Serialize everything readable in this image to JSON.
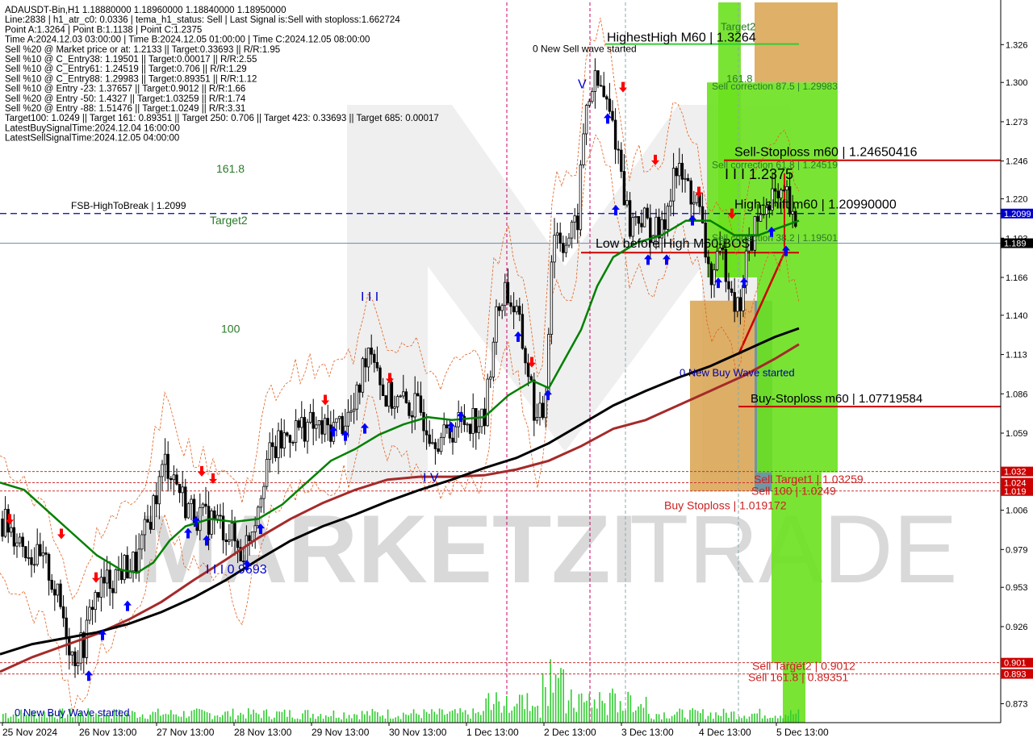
{
  "header_lines": [
    "ADAUSDT-Bin,H1  1.18880000 1.18960000 1.18840000 1.18950000",
    "Line:2838 | h1_atr_c0: 0.0336 | tema_h1_status: Sell | Last Signal is:Sell with stoploss:1.662724",
    "Point A:1.3264 | Point B:1.1138 | Point C:1.2375",
    "Time A:2024.12.03 03:00:00 | Time B:2024.12.05 01:00:00 | Time C:2024.12.05 08:00:00",
    "Sell %20 @ Market price or at: 1.2133 || Target:0.33693 || R/R:1.95",
    "Sell %10 @ C_Entry38: 1.19501 || Target:0.00017 || R/R:2.55",
    "Sell %10 @ C_Entry61: 1.24519 || Target:0.706 || R/R:1.29",
    "Sell %10 @ C_Entry88: 1.29983 || Target:0.89351 || R/R:1.12",
    "Sell %10 @ Entry -23: 1.37657 || Target:0.9012 || R/R:1.66",
    "Sell %20 @ Entry -50: 1.4327 || Target:1.03259 || R/R:1.74",
    "Sell %20 @ Entry -88: 1.51476 || Target:1.0249 || R/R:3.31",
    "Target100: 1.0249 || Target 161: 0.89351 || Target 250: 0.706 || Target 423: 0.33693 || Target 685: 0.00017",
    "LatestBuySignalTime:2024.12.04 16:00:00",
    "LatestSellSignalTime:2024.12.05 04:00:00"
  ],
  "watermark": {
    "brand": "MARKETZI",
    "suffix": "TRADE"
  },
  "colors": {
    "bull_green": "#6be11e",
    "orange_zone": "#d9a24e",
    "steel_zone": "#5f8c9a",
    "red_line": "#cc0000",
    "blue_dash": "#0000aa",
    "ema_green": "#008000",
    "ema_black": "#000000",
    "ema_darkred": "#a52a2a",
    "arrow_up": "#0000ff",
    "arrow_down": "#ff0000"
  },
  "chart_labels": {
    "left_fib_161": "161.8",
    "left_target2": "Target2",
    "left_100": "100",
    "fsb": "FSB-HighToBreak | 1.2099",
    "highest_high": "HighestHigh   M60 | 1.3264",
    "new_sell_wave": "0 New Sell wave started",
    "target2_top": "Target2",
    "fib_161_top": "161.8",
    "sell_corr_875": "Sell correction 87.5 | 1.29983",
    "sell_stoploss": "Sell-Stoploss m60 | 1.24650416",
    "sell_corr_618": "Sell correction 61.8 | 1.24519",
    "point_c": "I I I 1.2375",
    "high_shift": "High-shift m60 | 1.20990000",
    "low_before_high": "Low before High   M60-BOS",
    "sell_corr_382": "Sell correction 38.2 | 1.19501",
    "new_buy_wave_mid": "0 New Buy Wave started",
    "buy_stoploss": "Buy-Stoploss m60 | 1.07719584",
    "sell_target1": "Sell Target1 | 1.03259",
    "sell_100": "Sell 100 | 1.0249",
    "buy_stoploss_low": "Buy Stoploss | 1.019172",
    "sell_target2": "Sell Target2 | 0.9012",
    "sell_1618": "Sell 161.8 | 0.89351",
    "wave_low": "I I I 0.9693",
    "wave_iii": "I I I",
    "wave_iv": "I V",
    "wave_v": "V",
    "new_buy_wave_bottom": "0 New Buy Wave started"
  },
  "axis_badges": [
    {
      "text": "1.2099",
      "value": 1.2099,
      "bg": "#0000cc"
    },
    {
      "text": "1.189",
      "value": 1.1895,
      "bg": "#000000"
    },
    {
      "text": "1.032",
      "value": 1.0326,
      "bg": "#cc0000"
    },
    {
      "text": "1.024",
      "value": 1.0249,
      "bg": "#cc0000"
    },
    {
      "text": "1.019",
      "value": 1.0192,
      "bg": "#cc0000"
    },
    {
      "text": "0.901",
      "value": 0.9012,
      "bg": "#cc0000"
    },
    {
      "text": "0.893",
      "value": 0.8935,
      "bg": "#cc0000"
    }
  ],
  "chart_data": {
    "type": "candlestick",
    "symbol": "ADAUSDT-Bin",
    "timeframe": "H1",
    "y_ticks": [
      "1.326",
      "1.300",
      "1.273",
      "1.246",
      "1.220",
      "1.193",
      "1.166",
      "1.140",
      "1.113",
      "1.086",
      "1.059",
      "1.033",
      "1.006",
      "0.979",
      "0.953",
      "0.926",
      "0.873"
    ],
    "ylim": [
      0.86,
      1.355
    ],
    "x_ticks": [
      "25 Nov 2024",
      "26 Nov 13:00",
      "27 Nov 13:00",
      "28 Nov 13:00",
      "29 Nov 13:00",
      "30 Nov 13:00",
      "1 Dec 13:00",
      "2 Dec 13:00",
      "3 Dec 13:00",
      "4 Dec 13:00",
      "5 Dec 13:00"
    ],
    "close_path": [
      [
        0,
        1.0
      ],
      [
        20,
        0.99
      ],
      [
        40,
        0.975
      ],
      [
        60,
        0.965
      ],
      [
        80,
        0.93
      ],
      [
        90,
        0.905
      ],
      [
        105,
        0.915
      ],
      [
        115,
        0.945
      ],
      [
        130,
        0.955
      ],
      [
        150,
        0.965
      ],
      [
        170,
        0.97
      ],
      [
        190,
        1.01
      ],
      [
        205,
        1.04
      ],
      [
        215,
        1.03
      ],
      [
        230,
        1.01
      ],
      [
        250,
        1.0
      ],
      [
        265,
        1.0
      ],
      [
        285,
        0.99
      ],
      [
        300,
        0.975
      ],
      [
        315,
        1.0
      ],
      [
        330,
        1.04
      ],
      [
        345,
        1.05
      ],
      [
        360,
        1.06
      ],
      [
        380,
        1.065
      ],
      [
        400,
        1.06
      ],
      [
        420,
        1.065
      ],
      [
        440,
        1.075
      ],
      [
        455,
        1.12
      ],
      [
        465,
        1.115
      ],
      [
        475,
        1.085
      ],
      [
        495,
        1.08
      ],
      [
        520,
        1.075
      ],
      [
        535,
        1.06
      ],
      [
        550,
        1.055
      ],
      [
        565,
        1.065
      ],
      [
        585,
        1.07
      ],
      [
        600,
        1.065
      ],
      [
        612,
        1.13
      ],
      [
        625,
        1.16
      ],
      [
        640,
        1.14
      ],
      [
        655,
        1.1
      ],
      [
        665,
        1.065
      ],
      [
        675,
        1.075
      ],
      [
        685,
        1.2
      ],
      [
        700,
        1.19
      ],
      [
        715,
        1.2
      ],
      [
        725,
        1.28
      ],
      [
        735,
        1.3
      ],
      [
        745,
        1.295
      ],
      [
        760,
        1.27
      ],
      [
        770,
        1.24
      ],
      [
        780,
        1.2
      ],
      [
        790,
        1.21
      ],
      [
        805,
        1.2
      ],
      [
        820,
        1.195
      ],
      [
        835,
        1.24
      ],
      [
        850,
        1.23
      ],
      [
        865,
        1.215
      ],
      [
        880,
        1.165
      ],
      [
        895,
        1.18
      ],
      [
        905,
        1.165
      ],
      [
        915,
        1.14
      ],
      [
        925,
        1.18
      ],
      [
        935,
        1.2
      ],
      [
        945,
        1.21
      ],
      [
        955,
        1.225
      ],
      [
        965,
        1.215
      ],
      [
        975,
        1.22
      ],
      [
        985,
        1.195
      ]
    ],
    "ema_green": [
      [
        0,
        1.025
      ],
      [
        30,
        1.02
      ],
      [
        60,
        1.005
      ],
      [
        90,
        0.99
      ],
      [
        120,
        0.975
      ],
      [
        150,
        0.965
      ],
      [
        170,
        0.963
      ],
      [
        190,
        0.97
      ],
      [
        210,
        0.985
      ],
      [
        230,
        0.995
      ],
      [
        260,
        1.0
      ],
      [
        290,
        0.998
      ],
      [
        320,
        1.0
      ],
      [
        350,
        1.01
      ],
      [
        380,
        1.025
      ],
      [
        410,
        1.04
      ],
      [
        440,
        1.048
      ],
      [
        470,
        1.058
      ],
      [
        500,
        1.065
      ],
      [
        530,
        1.07
      ],
      [
        560,
        1.068
      ],
      [
        600,
        1.07
      ],
      [
        630,
        1.085
      ],
      [
        660,
        1.095
      ],
      [
        680,
        1.09
      ],
      [
        700,
        1.11
      ],
      [
        720,
        1.13
      ],
      [
        740,
        1.16
      ],
      [
        760,
        1.18
      ],
      [
        790,
        1.19
      ],
      [
        820,
        1.195
      ],
      [
        850,
        1.205
      ],
      [
        880,
        1.205
      ],
      [
        910,
        1.195
      ],
      [
        940,
        1.195
      ],
      [
        965,
        1.2
      ],
      [
        990,
        1.205
      ]
    ],
    "ema_black": [
      [
        0,
        0.907
      ],
      [
        40,
        0.914
      ],
      [
        80,
        0.918
      ],
      [
        120,
        0.922
      ],
      [
        160,
        0.928
      ],
      [
        200,
        0.936
      ],
      [
        240,
        0.946
      ],
      [
        280,
        0.958
      ],
      [
        320,
        0.972
      ],
      [
        360,
        0.985
      ],
      [
        400,
        0.995
      ],
      [
        440,
        1.003
      ],
      [
        480,
        1.012
      ],
      [
        520,
        1.02
      ],
      [
        560,
        1.027
      ],
      [
        600,
        1.035
      ],
      [
        640,
        1.042
      ],
      [
        680,
        1.052
      ],
      [
        720,
        1.065
      ],
      [
        760,
        1.078
      ],
      [
        800,
        1.088
      ],
      [
        840,
        1.097
      ],
      [
        880,
        1.105
      ],
      [
        920,
        1.115
      ],
      [
        960,
        1.125
      ],
      [
        990,
        1.131
      ]
    ],
    "ema_darkred": [
      [
        0,
        0.895
      ],
      [
        40,
        0.905
      ],
      [
        80,
        0.913
      ],
      [
        120,
        0.921
      ],
      [
        160,
        0.931
      ],
      [
        200,
        0.943
      ],
      [
        240,
        0.958
      ],
      [
        280,
        0.972
      ],
      [
        320,
        0.987
      ],
      [
        360,
        1.0
      ],
      [
        400,
        1.011
      ],
      [
        440,
        1.02
      ],
      [
        480,
        1.027
      ],
      [
        520,
        1.029
      ],
      [
        560,
        1.029
      ],
      [
        600,
        1.03
      ],
      [
        640,
        1.034
      ],
      [
        680,
        1.04
      ],
      [
        720,
        1.05
      ],
      [
        760,
        1.062
      ],
      [
        800,
        1.068
      ],
      [
        840,
        1.078
      ],
      [
        880,
        1.088
      ],
      [
        920,
        1.098
      ],
      [
        960,
        1.11
      ],
      [
        990,
        1.12
      ]
    ],
    "up_arrows": [
      [
        110,
        0.892
      ],
      [
        127,
        0.92
      ],
      [
        158,
        0.94
      ],
      [
        233,
        0.99
      ],
      [
        243,
        0.998
      ],
      [
        256,
        0.985
      ],
      [
        306,
        0.968
      ],
      [
        323,
        0.993
      ],
      [
        413,
        1.06
      ],
      [
        428,
        1.057
      ],
      [
        452,
        1.062
      ],
      [
        559,
        1.063
      ],
      [
        571,
        1.07
      ],
      [
        642,
        1.125
      ],
      [
        679,
        1.085
      ],
      [
        753,
        1.275
      ],
      [
        763,
        1.212
      ],
      [
        803,
        1.178
      ],
      [
        826,
        1.178
      ],
      [
        858,
        1.205
      ],
      [
        890,
        1.162
      ],
      [
        922,
        1.162
      ],
      [
        956,
        1.197
      ],
      [
        974,
        1.184
      ]
    ],
    "down_arrows": [
      [
        12,
        1.0
      ],
      [
        76,
        0.99
      ],
      [
        119,
        0.96
      ],
      [
        250,
        1.033
      ],
      [
        264,
        1.028
      ],
      [
        403,
        1.082
      ],
      [
        483,
        1.097
      ],
      [
        659,
        1.108
      ],
      [
        772,
        1.297
      ],
      [
        812,
        1.247
      ],
      [
        866,
        1.225
      ],
      [
        907,
        1.21
      ]
    ]
  }
}
